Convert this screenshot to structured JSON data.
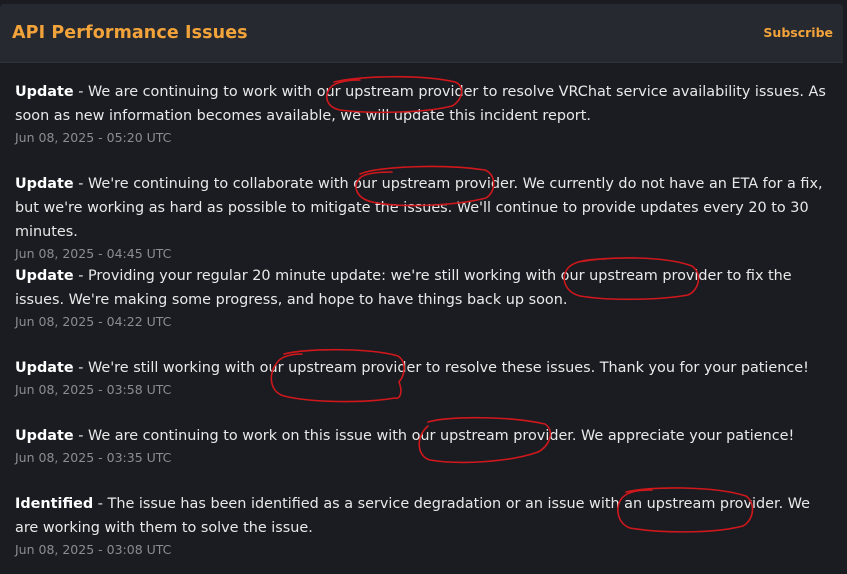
{
  "header": {
    "title": "API Performance Issues",
    "subscribe_label": "Subscribe"
  },
  "updates": [
    {
      "status": "Update",
      "separator": " - ",
      "message": "We are continuing to work with our upstream provider to resolve VRChat service availability issues. As soon as new information becomes available, we will update this incident report.",
      "timestamp": "Jun 08, 2025 - 05:20 UTC"
    },
    {
      "status": "Update",
      "separator": " - ",
      "message": "We're continuing to collaborate with our upstream provider. We currently do not have an ETA for a fix, but we're working as hard as possible to mitigate the issues. We'll continue to provide updates every 20 to 30 minutes.",
      "timestamp": "Jun 08, 2025 - 04:45 UTC"
    },
    {
      "status": "Update",
      "separator": " - ",
      "message": "Providing your regular 20 minute update: we're still working with our upstream provider to fix the issues. We're making some progress, and hope to have things back up soon.",
      "timestamp": "Jun 08, 2025 - 04:22 UTC"
    },
    {
      "status": "Update",
      "separator": " - ",
      "message": "We're still working with our upstream provider to resolve these issues. Thank you for your patience!",
      "timestamp": "Jun 08, 2025 - 03:58 UTC"
    },
    {
      "status": "Update",
      "separator": " - ",
      "message": "We are continuing to work on this issue with our upstream provider. We appreciate your patience!",
      "timestamp": "Jun 08, 2025 - 03:35 UTC"
    },
    {
      "status": "Identified",
      "separator": " - ",
      "message": "The issue has been identified as a service degradation or an issue with an upstream provider. We are working with them to solve the issue.",
      "timestamp": "Jun 08, 2025 - 03:08 UTC"
    }
  ],
  "colors": {
    "background": "#1a1c21",
    "header_background": "#262930",
    "accent": "#f2a33a",
    "text": "#e9e9ea",
    "timestamp": "#8b8d93",
    "annotation": "#d0181c"
  }
}
